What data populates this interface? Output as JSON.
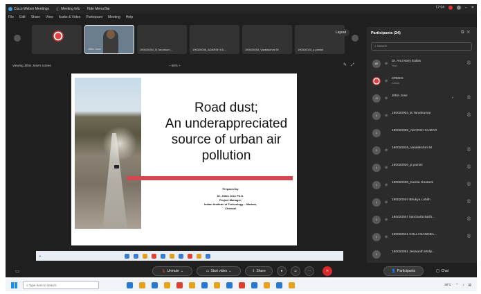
{
  "titlebar": {
    "app": "Cisco Webex Meetings",
    "meeting_info": "Meeting Info",
    "hide_menu": "Hide Menu Bar",
    "clock": "17:04"
  },
  "menu": [
    "File",
    "Edit",
    "Share",
    "View",
    "Audio & Video",
    "Participant",
    "Meeting",
    "Help"
  ],
  "strip": {
    "tiles": [
      {
        "name": "",
        "kind": "logo"
      },
      {
        "name": "Jithin Jose",
        "kind": "person",
        "active": true
      },
      {
        "name": "190020004_B.Tarunkum...",
        "kind": "blank"
      },
      {
        "name": "190020008_ADARSH KU...",
        "kind": "blank"
      },
      {
        "name": "190020018_Varalakshmi M",
        "kind": "blank"
      },
      {
        "name": "190020020_p.yamini",
        "kind": "blank"
      }
    ],
    "layout_label": "Layout"
  },
  "share": {
    "viewing": "Viewing Jithin Jose's screen",
    "zoom": "66%"
  },
  "slide": {
    "title_lines": [
      "Road dust;",
      "An underappreciated",
      "source of urban air",
      "pollution"
    ],
    "prepared_lines": [
      "Prepared by",
      "",
      "Dr. Jithin Jose Ph.D.",
      "Project Manager,",
      "Indian Institute of Technology – Madras,",
      "Chennai"
    ]
  },
  "participants": {
    "header": "Participants (24)",
    "search_placeholder": "Search",
    "list": [
      {
        "avatar": "AE",
        "name": "Dr. Anu Mary Ealias",
        "sub": "Host"
      },
      {
        "avatar": "logo",
        "name": "CREES",
        "sub": "Cohost"
      },
      {
        "avatar": "JJ",
        "name": "Jithin Jose",
        "sub": ""
      },
      {
        "avatar": "1",
        "name": "190020004_B.Tarunkumar",
        "sub": ""
      },
      {
        "avatar": "1",
        "name": "190020008_ADARSH KUMAR",
        "sub": ""
      },
      {
        "avatar": "1",
        "name": "190020018_Varalakshmi M",
        "sub": ""
      },
      {
        "avatar": "1",
        "name": "190020020_p.yamini",
        "sub": ""
      },
      {
        "avatar": "1",
        "name": "190020030_Kamta Goutami",
        "sub": ""
      },
      {
        "avatar": "1",
        "name": "190020034 Bhukya Lohith",
        "sub": ""
      },
      {
        "avatar": "1",
        "name": "190020037 kancharla karth...",
        "sub": ""
      },
      {
        "avatar": "1",
        "name": "190020041 KOLLI MANOBA...",
        "sub": ""
      },
      {
        "avatar": "1",
        "name": "190020091 Jeswanth Molly...",
        "sub": ""
      }
    ]
  },
  "controls": {
    "unmute": "Unmute",
    "start_video": "Start video",
    "share": "Share",
    "participants": "Participants",
    "chat": "Chat"
  },
  "host_taskbar": {
    "search_placeholder": "Type here to search",
    "tray": "30°C"
  },
  "colors": {
    "accent_red": "#d4474f",
    "end_button": "#d92b2b"
  }
}
